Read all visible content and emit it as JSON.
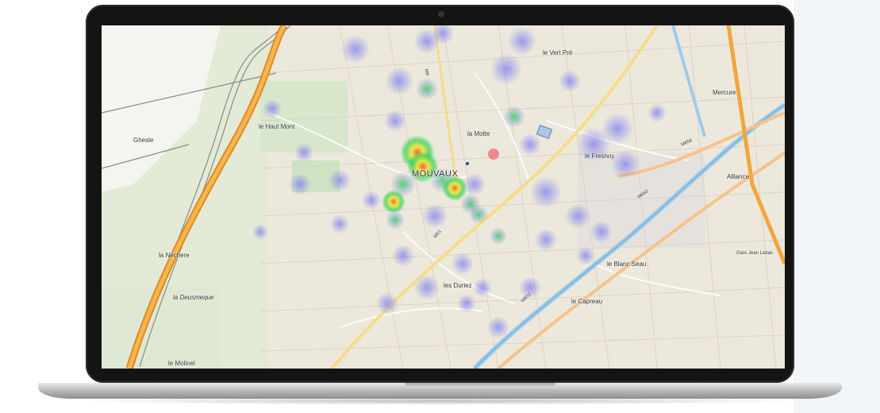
{
  "map": {
    "place_labels": [
      {
        "id": "le-vert-pre",
        "text": "le Vert Pré"
      },
      {
        "id": "le-haut-mont",
        "text": "le Haut Mont"
      },
      {
        "id": "la-motte",
        "text": "la Motte"
      },
      {
        "id": "mouvaux",
        "text": "MOUVAUX"
      },
      {
        "id": "le-fresnoy",
        "text": "le Fresnoy"
      },
      {
        "id": "ghesle",
        "text": "Ghesle"
      },
      {
        "id": "la-nechere",
        "text": "la Nechere"
      },
      {
        "id": "la-deusmeque",
        "text": "la Deusmeque"
      },
      {
        "id": "les-duriez",
        "text": "les Duriez"
      },
      {
        "id": "le-blanc-seau",
        "text": "le Blanc Seau"
      },
      {
        "id": "le-capreau",
        "text": "le Capreau"
      },
      {
        "id": "le-molinel",
        "text": "le Molinel"
      },
      {
        "id": "mercure",
        "text": "Mercure"
      },
      {
        "id": "alliance",
        "text": "Alliance"
      },
      {
        "id": "gare-jean-lebas",
        "text": "Gare Jean Lebas"
      }
    ],
    "road_labels": [
      {
        "id": "m9",
        "text": "M9"
      },
      {
        "id": "m656",
        "text": "M656"
      },
      {
        "id": "m660",
        "text": "M660"
      },
      {
        "id": "m51",
        "text": "M51"
      },
      {
        "id": "m652",
        "text": "M652"
      }
    ],
    "colors": {
      "motorway": "#f3a63b",
      "heat_low": "#8c8cf0",
      "heat_mid": "#39d15a",
      "heat_high": "#f2e63a",
      "heat_peak": "#f45a2a",
      "canal": "#9ecbe8"
    }
  }
}
